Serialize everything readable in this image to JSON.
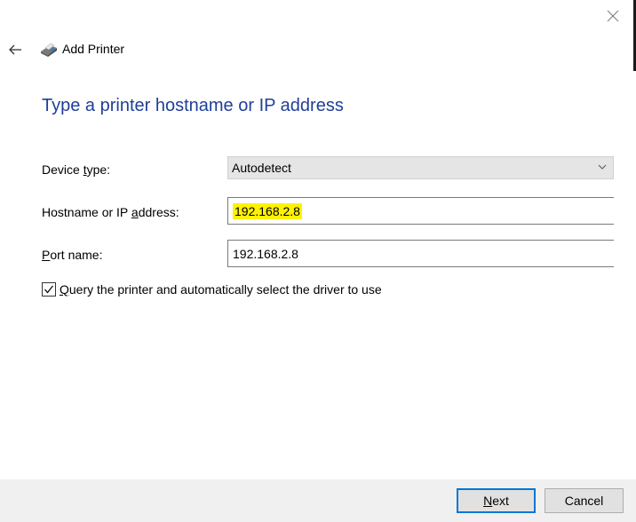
{
  "window": {
    "title": "Add Printer"
  },
  "page": {
    "heading": "Type a printer hostname or IP address"
  },
  "form": {
    "device_type": {
      "label_pre": "Device ",
      "label_key": "t",
      "label_post": "ype:",
      "value": "Autodetect"
    },
    "hostname": {
      "label_pre": "Hostname or IP ",
      "label_key": "a",
      "label_post": "ddress:",
      "value": "192.168.2.8"
    },
    "port_name": {
      "label_pre": "",
      "label_key": "P",
      "label_post": "ort name:",
      "value": "192.168.2.8"
    },
    "query_checkbox": {
      "label_key": "Q",
      "label_post": "uery the printer and automatically select the driver to use",
      "checked": true
    }
  },
  "footer": {
    "next_key": "N",
    "next_post": "ext",
    "cancel_label": "Cancel"
  },
  "colors": {
    "heading": "#1f3f99",
    "highlight": "#fff200",
    "accent": "#0078d7"
  },
  "icons": {
    "close": "close-icon",
    "back": "back-arrow-icon",
    "printer": "printer-icon",
    "dropdown": "chevron-down-icon",
    "check": "checkmark-icon"
  }
}
